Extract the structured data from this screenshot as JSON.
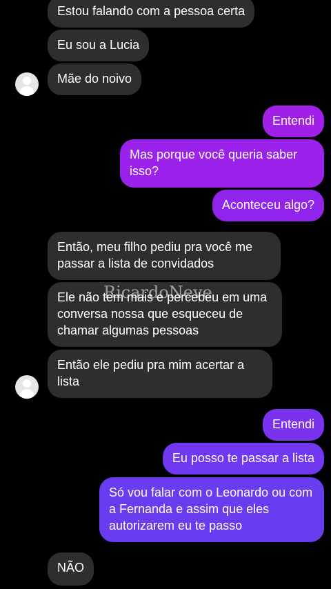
{
  "colors": {
    "background": "#000000",
    "incoming_bubble": "#2e2e2e",
    "outgoing_magenta": "#a020e8",
    "outgoing_violet": "#8a2cf0",
    "outgoing_blue_violet": "#6a3cf0"
  },
  "messages": [
    {
      "side": "in",
      "text": "Estou falando com a pessoa certa"
    },
    {
      "side": "in",
      "text": "Eu sou a Lucia"
    },
    {
      "side": "in",
      "text": "Mãe do noivo"
    },
    {
      "side": "out",
      "text": "Entendi"
    },
    {
      "side": "out",
      "text": "Mas porque você queria saber isso?"
    },
    {
      "side": "out",
      "text": "Aconteceu algo?"
    },
    {
      "side": "in",
      "text": "Então, meu filho pediu pra você me passar a lista de convidados"
    },
    {
      "side": "in",
      "text": "Ele não tem mais e percebeu em uma conversa nossa que esqueceu de chamar algumas pessoas"
    },
    {
      "side": "in",
      "text": "Então ele pediu pra mim acertar a lista"
    },
    {
      "side": "out",
      "text": "Entendi"
    },
    {
      "side": "out",
      "text": "Eu posso te passar a lista"
    },
    {
      "side": "out",
      "text": "Só vou falar com o Leonardo ou com a Fernanda e assim que eles autorizarem eu te passo"
    },
    {
      "side": "in",
      "text": "NÃO"
    }
  ],
  "watermark": "RicardoNeve"
}
